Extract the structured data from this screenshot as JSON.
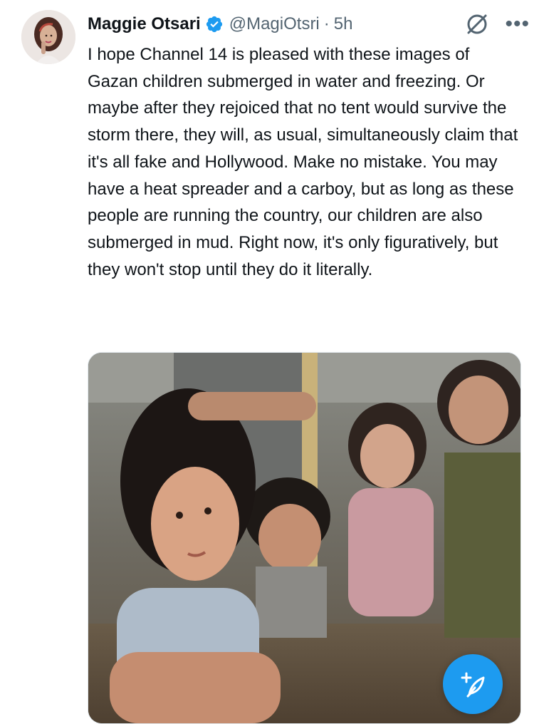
{
  "tweet": {
    "author_name": "Maggie Otsari",
    "handle": "@MagiOtsri",
    "separator": "·",
    "time": "5h",
    "text": "I hope Channel 14 is pleased with these images of Gazan children submerged in water and freezing. Or maybe after they rejoiced that no tent would survive the storm there, they will, as usual, simultaneously claim that it's all fake and Hollywood. Make no mistake. You may have a heat spreader and a carboy, but as long as these people are running the country, our children are also submerged in mud. Right now, it's only figuratively, but they won't stop until they do it literally."
  },
  "icons": {
    "verified": "verified-badge-icon",
    "grok": "grok-icon",
    "more": "more-icon",
    "compose": "compose-post-icon"
  },
  "colors": {
    "accent": "#1d9bf0",
    "text": "#0f1419",
    "secondary": "#536471"
  }
}
